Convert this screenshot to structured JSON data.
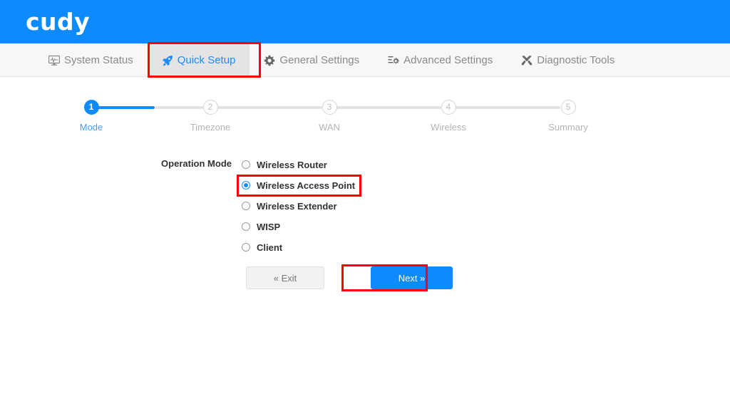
{
  "brand": {
    "logo_text": "cudy",
    "header_color": "#0d8bfd",
    "accent_color": "#1b8cf9",
    "highlight_color": "#ff0000"
  },
  "nav": {
    "items": [
      {
        "label": "System Status",
        "icon": "monitor-pulse-icon",
        "active": false
      },
      {
        "label": "Quick Setup",
        "icon": "rocket-icon",
        "active": true
      },
      {
        "label": "General Settings",
        "icon": "gear-icon",
        "active": false
      },
      {
        "label": "Advanced Settings",
        "icon": "sliders-gear-icon",
        "active": false
      },
      {
        "label": "Diagnostic Tools",
        "icon": "tools-icon",
        "active": false
      }
    ]
  },
  "stepper": {
    "current": 1,
    "steps": [
      {
        "number": "1",
        "label": "Mode"
      },
      {
        "number": "2",
        "label": "Timezone"
      },
      {
        "number": "3",
        "label": "WAN"
      },
      {
        "number": "4",
        "label": "Wireless"
      },
      {
        "number": "5",
        "label": "Summary"
      }
    ]
  },
  "form": {
    "field_label": "Operation Mode",
    "options": [
      {
        "label": "Wireless Router",
        "checked": false
      },
      {
        "label": "Wireless Access Point",
        "checked": true
      },
      {
        "label": "Wireless Extender",
        "checked": false
      },
      {
        "label": "WISP",
        "checked": false
      },
      {
        "label": "Client",
        "checked": false
      }
    ]
  },
  "buttons": {
    "exit": "« Exit",
    "next": "Next »"
  }
}
